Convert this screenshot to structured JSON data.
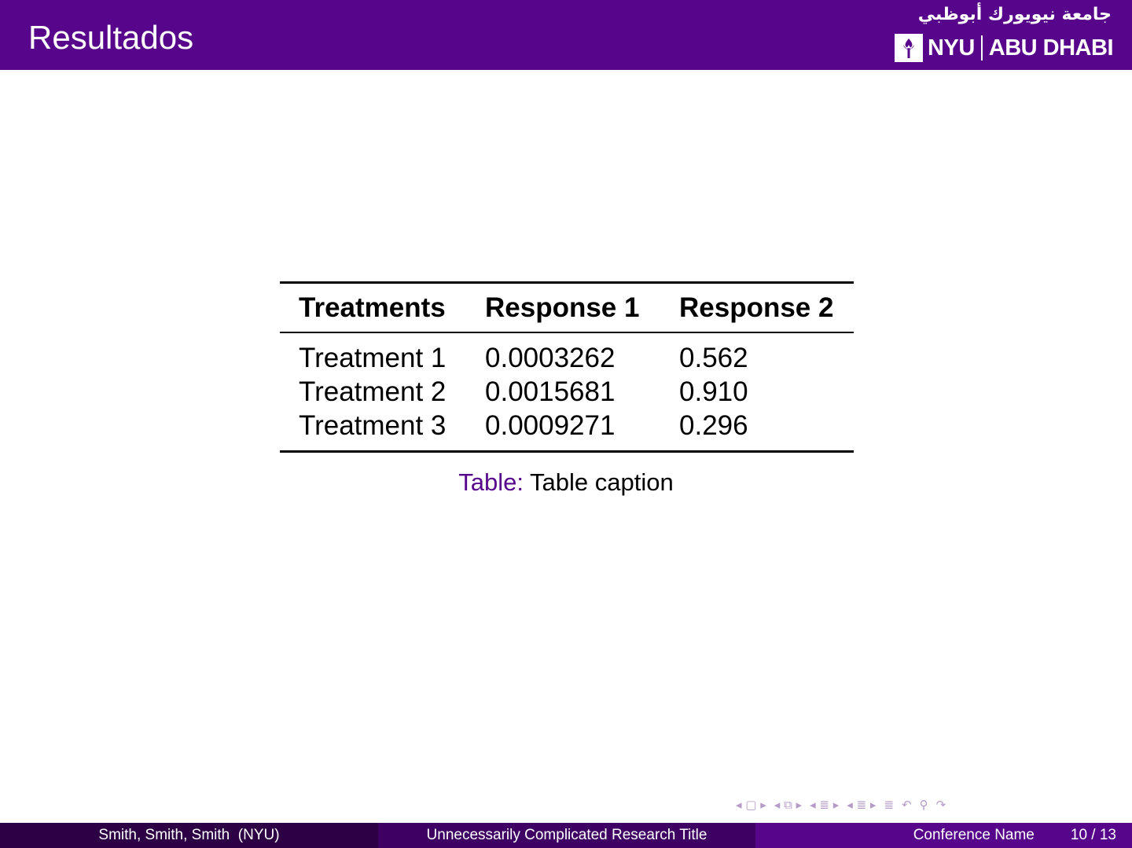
{
  "header": {
    "title": "Resultados",
    "logo": {
      "arabic": "جامعة نيويورك أبوظبي",
      "nyu": "NYU",
      "abu_dhabi": "ABU DHABI",
      "icon": "torch-icon"
    }
  },
  "table": {
    "headers": [
      "Treatments",
      "Response 1",
      "Response 2"
    ],
    "rows": [
      [
        "Treatment 1",
        "0.0003262",
        "0.562"
      ],
      [
        "Treatment 2",
        "0.0015681",
        "0.910"
      ],
      [
        "Treatment 3",
        "0.0009271",
        "0.296"
      ]
    ],
    "caption_label": "Table:",
    "caption_text": "Table caption"
  },
  "footer": {
    "authors": "Smith, Smith, Smith  (NYU)",
    "title": "Unnecessarily Complicated Research Title",
    "conference": "Conference Name",
    "page": "10 / 13"
  },
  "colors": {
    "brand": "#57068c",
    "footer_dark": "#2d0046",
    "footer_mid": "#3f0063",
    "nav": "#b49bc8"
  },
  "navigation": [
    "frame-nav-icon",
    "subsection-nav-icon",
    "section-nav-icon",
    "presentation-nav-icon",
    "appendix-icon",
    "back-icon",
    "search-icon",
    "forward-icon"
  ]
}
